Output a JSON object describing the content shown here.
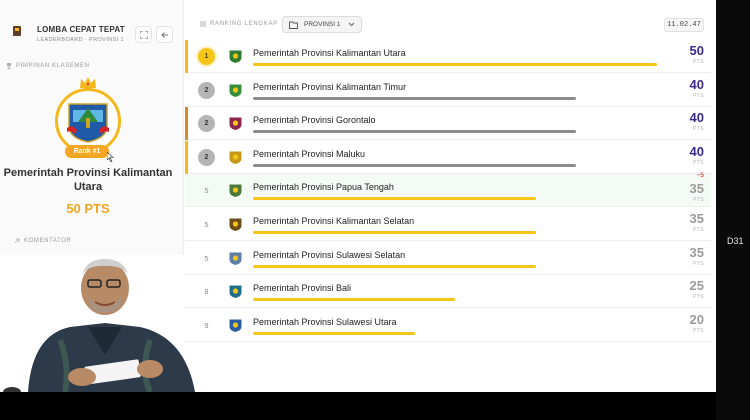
{
  "app": {
    "title": "LOMBA CEPAT TEPAT",
    "subtitle": "LEADERBOARD · PROVINSI 1"
  },
  "left_panel": {
    "leader_section_label": "PIMPINAN KLASEMEN",
    "rank_pill": "Rank #1",
    "leader_name": "Pemerintah Provinsi Kalimantan Utara",
    "leader_points": "50 PTS",
    "commentator_label": "KOMENTATOR"
  },
  "header": {
    "ranking_label": "RANKING LENGKAP",
    "dropdown_value": "PROVINSI 1",
    "clock": "11.02.47"
  },
  "colors": {
    "accent_gold": "#f5b71e",
    "bar_gold": "#f5c518",
    "bar_gray": "#8c8c8c",
    "points_purple": "#3b2a8c",
    "points_gray": "#9a9a9a"
  },
  "pts_unit": "PTS",
  "rows": [
    {
      "rank": "1",
      "name": "Pemerintah Provinsi Kalimantan Utara",
      "points": "50",
      "progress": 1.0,
      "bar": "gold",
      "badge": "gold",
      "stripe": "gold",
      "delta": "",
      "logo_color": "#2e7d32"
    },
    {
      "rank": "2",
      "name": "Pemerintah Provinsi Kalimantan Timur",
      "points": "40",
      "progress": 0.8,
      "bar": "gray",
      "badge": "silver",
      "stripe": "",
      "delta": "",
      "logo_color": "#388e3c"
    },
    {
      "rank": "2",
      "name": "Pemerintah Provinsi Gorontalo",
      "points": "40",
      "progress": 0.8,
      "bar": "gray",
      "badge": "silver",
      "stripe": "orange",
      "delta": "",
      "logo_color": "#8e244d"
    },
    {
      "rank": "2",
      "name": "Pemerintah Provinsi Maluku",
      "points": "40",
      "progress": 0.8,
      "bar": "gray",
      "badge": "silver",
      "stripe": "gold",
      "delta": "",
      "logo_color": "#c49a1a"
    },
    {
      "rank": "5",
      "name": "Pemerintah Provinsi Papua Tengah",
      "points": "35",
      "progress": 0.7,
      "bar": "gold",
      "badge": "plain",
      "stripe": "",
      "delta": "−5",
      "logo_color": "#4a7a3a"
    },
    {
      "rank": "5",
      "name": "Pemerintah Provinsi Kalimantan Selatan",
      "points": "35",
      "progress": 0.7,
      "bar": "gold",
      "badge": "plain",
      "stripe": "",
      "delta": "",
      "logo_color": "#6d4c1a"
    },
    {
      "rank": "5",
      "name": "Pemerintah Provinsi Sulawesi Selatan",
      "points": "35",
      "progress": 0.7,
      "bar": "gold",
      "badge": "plain",
      "stripe": "",
      "delta": "",
      "logo_color": "#5b7fa6"
    },
    {
      "rank": "8",
      "name": "Pemerintah Provinsi Bali",
      "points": "25",
      "progress": 0.5,
      "bar": "gold",
      "badge": "plain",
      "stripe": "",
      "delta": "",
      "logo_color": "#1f6f8b"
    },
    {
      "rank": "9",
      "name": "Pemerintah Provinsi Sulawesi Utara",
      "points": "20",
      "progress": 0.4,
      "bar": "gold",
      "badge": "plain",
      "stripe": "",
      "delta": "",
      "logo_color": "#2a5d9f"
    }
  ],
  "side_overlay_label": "D31"
}
